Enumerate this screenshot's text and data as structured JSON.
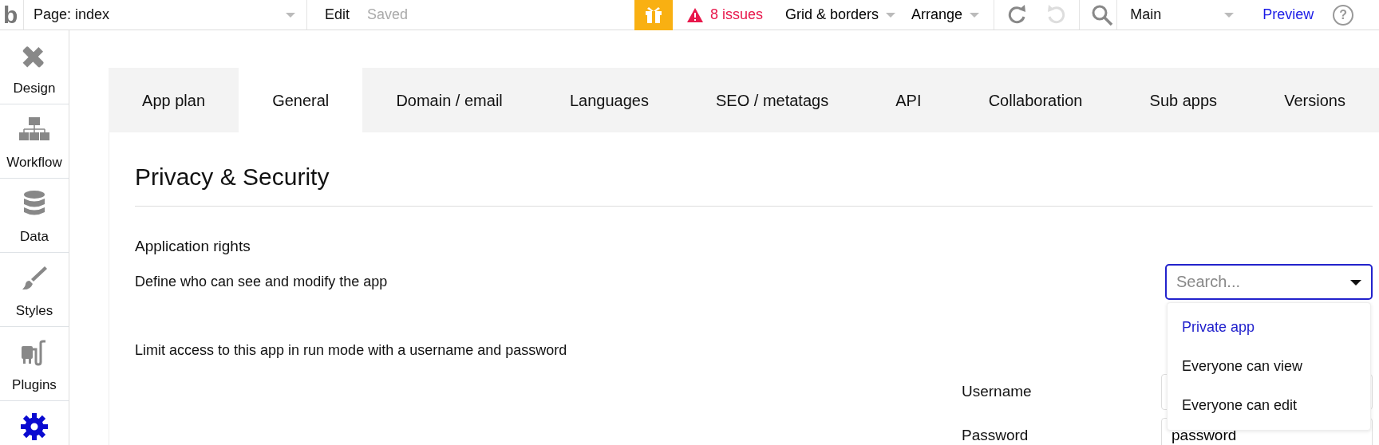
{
  "logo": "b",
  "page_selector": {
    "value": "Page: index"
  },
  "mode": "Edit",
  "save_status": "Saved",
  "issues": "8 issues",
  "menus": [
    {
      "label": "Grid & borders"
    },
    {
      "label": "Arrange"
    }
  ],
  "undo": {
    "disabled": false
  },
  "redo": {
    "disabled": true
  },
  "view_selector": {
    "value": "Main"
  },
  "preview": "Preview",
  "help": "?",
  "sidebar": {
    "items": [
      {
        "label": "Design",
        "selected": false
      },
      {
        "label": "Workflow",
        "selected": false
      },
      {
        "label": "Data",
        "selected": false
      },
      {
        "label": "Styles",
        "selected": false
      },
      {
        "label": "Plugins",
        "selected": false
      },
      {
        "selected": true
      }
    ]
  },
  "tabs": [
    {
      "label": "App plan",
      "selected": false
    },
    {
      "label": "General",
      "selected": true
    },
    {
      "label": "Domain / email",
      "selected": false
    },
    {
      "label": "Languages",
      "selected": false
    },
    {
      "label": "SEO / metatags",
      "selected": false
    },
    {
      "label": "API",
      "selected": false
    },
    {
      "label": "Collaboration",
      "selected": false
    },
    {
      "label": "Sub apps",
      "selected": false
    },
    {
      "label": "Versions",
      "selected": false
    }
  ],
  "section_title": "Privacy & Security",
  "rights_heading": "Application rights",
  "rights_description": "Define who can see and modify the app",
  "rights_dropdown": {
    "placeholder": "Search...",
    "options": [
      {
        "label": "Private app",
        "selected": true
      },
      {
        "label": "Everyone can view",
        "selected": false
      },
      {
        "label": "Everyone can edit",
        "selected": false
      }
    ]
  },
  "limit_access": "Limit access to this app in run mode with a username and password",
  "credentials": [
    {
      "label": "Username"
    },
    {
      "label": "Password",
      "value": "password"
    }
  ]
}
